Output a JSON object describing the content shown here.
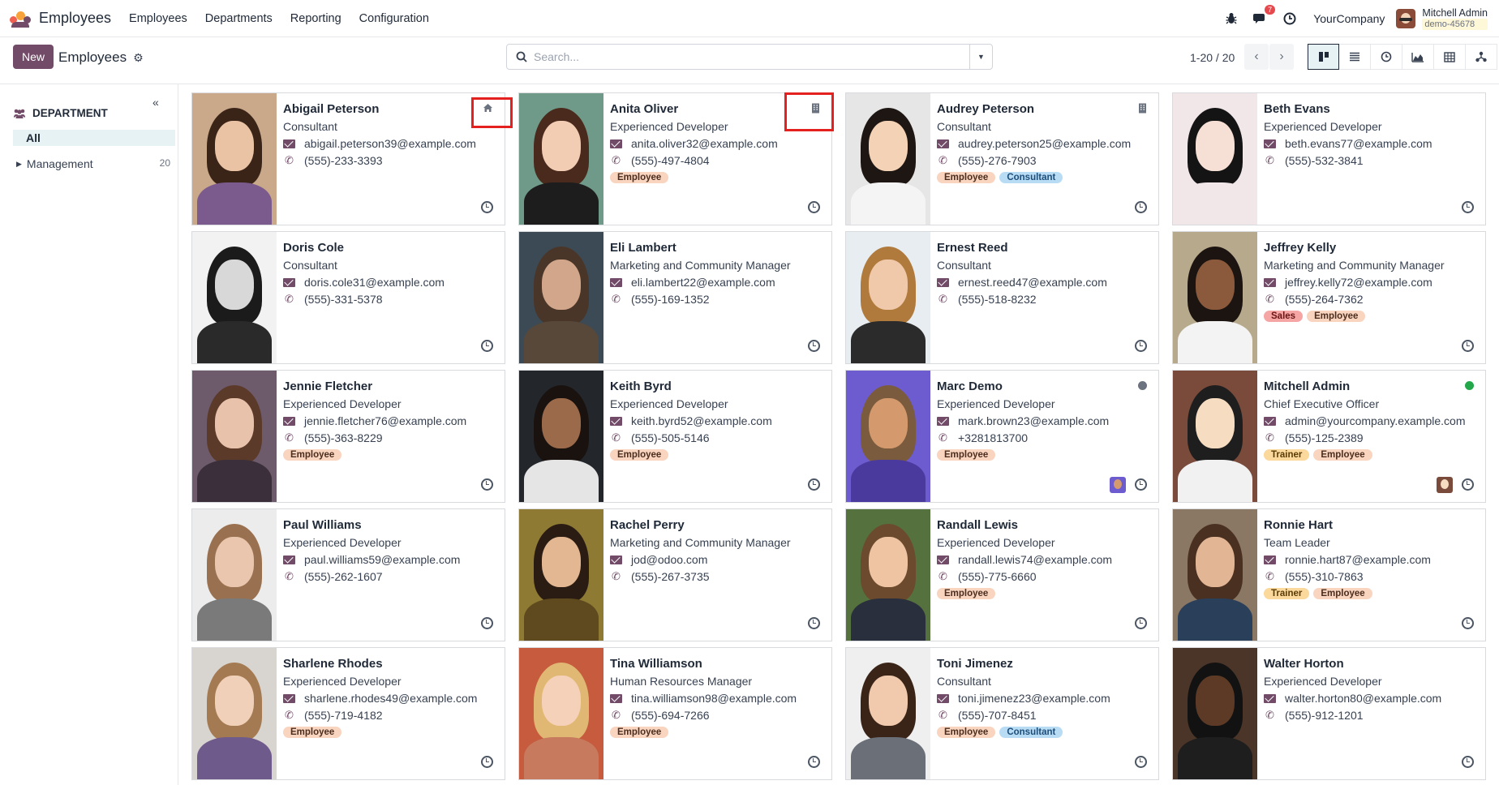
{
  "app": {
    "title": "Employees",
    "menu": [
      "Employees",
      "Departments",
      "Reporting",
      "Configuration"
    ],
    "notification_count": "7",
    "company": "YourCompany",
    "user_name": "Mitchell Admin",
    "database": "demo-45678"
  },
  "control": {
    "new_label": "New",
    "breadcrumb": "Employees",
    "search_placeholder": "Search...",
    "pager": "1-20 / 20"
  },
  "sidebar": {
    "header": "DEPARTMENT",
    "all_label": "All",
    "items": [
      {
        "label": "Management",
        "count": "20"
      }
    ]
  },
  "colors": {
    "brand": "#714b67",
    "highlight": "#e5211f",
    "online": "#22a84a",
    "offline": "#6b7280"
  },
  "employees": [
    {
      "name": "Abigail Peterson",
      "job": "Consultant",
      "email": "abigail.peterson39@example.com",
      "phone": "(555)-233-3393",
      "tags": [],
      "corner_icon": "home-icon"
    },
    {
      "name": "Anita Oliver",
      "job": "Experienced Developer",
      "email": "anita.oliver32@example.com",
      "phone": "(555)-497-4804",
      "tags": [
        "Employee"
      ],
      "corner_icon": "building-icon"
    },
    {
      "name": "Audrey Peterson",
      "job": "Consultant",
      "email": "audrey.peterson25@example.com",
      "phone": "(555)-276-7903",
      "tags": [
        "Employee",
        "Consultant"
      ],
      "corner_icon": "building-icon"
    },
    {
      "name": "Beth Evans",
      "job": "Experienced Developer",
      "email": "beth.evans77@example.com",
      "phone": "(555)-532-3841",
      "tags": []
    },
    {
      "name": "Doris Cole",
      "job": "Consultant",
      "email": "doris.cole31@example.com",
      "phone": "(555)-331-5378",
      "tags": []
    },
    {
      "name": "Eli Lambert",
      "job": "Marketing and Community Manager",
      "email": "eli.lambert22@example.com",
      "phone": "(555)-169-1352",
      "tags": []
    },
    {
      "name": "Ernest Reed",
      "job": "Consultant",
      "email": "ernest.reed47@example.com",
      "phone": "(555)-518-8232",
      "tags": []
    },
    {
      "name": "Jeffrey Kelly",
      "job": "Marketing and Community Manager",
      "email": "jeffrey.kelly72@example.com",
      "phone": "(555)-264-7362",
      "tags": [
        "Sales",
        "Employee"
      ]
    },
    {
      "name": "Jennie Fletcher",
      "job": "Experienced Developer",
      "email": "jennie.fletcher76@example.com",
      "phone": "(555)-363-8229",
      "tags": [
        "Employee"
      ]
    },
    {
      "name": "Keith Byrd",
      "job": "Experienced Developer",
      "email": "keith.byrd52@example.com",
      "phone": "(555)-505-5146",
      "tags": [
        "Employee"
      ]
    },
    {
      "name": "Marc Demo",
      "job": "Experienced Developer",
      "email": "mark.brown23@example.com",
      "phone": "+3281813700",
      "tags": [
        "Employee"
      ],
      "status": "offline",
      "mini_avatar": true
    },
    {
      "name": "Mitchell Admin",
      "job": "Chief Executive Officer",
      "email": "admin@yourcompany.example.com",
      "phone": "(555)-125-2389",
      "tags": [
        "Trainer",
        "Employee"
      ],
      "status": "online",
      "mini_avatar": true
    },
    {
      "name": "Paul Williams",
      "job": "Experienced Developer",
      "email": "paul.williams59@example.com",
      "phone": "(555)-262-1607",
      "tags": []
    },
    {
      "name": "Rachel Perry",
      "job": "Marketing and Community Manager",
      "email": "jod@odoo.com",
      "phone": "(555)-267-3735",
      "tags": []
    },
    {
      "name": "Randall Lewis",
      "job": "Experienced Developer",
      "email": "randall.lewis74@example.com",
      "phone": "(555)-775-6660",
      "tags": [
        "Employee"
      ]
    },
    {
      "name": "Ronnie Hart",
      "job": "Team Leader",
      "email": "ronnie.hart87@example.com",
      "phone": "(555)-310-7863",
      "tags": [
        "Trainer",
        "Employee"
      ]
    },
    {
      "name": "Sharlene Rhodes",
      "job": "Experienced Developer",
      "email": "sharlene.rhodes49@example.com",
      "phone": "(555)-719-4182",
      "tags": [
        "Employee"
      ]
    },
    {
      "name": "Tina Williamson",
      "job": "Human Resources Manager",
      "email": "tina.williamson98@example.com",
      "phone": "(555)-694-7266",
      "tags": [
        "Employee"
      ]
    },
    {
      "name": "Toni Jimenez",
      "job": "Consultant",
      "email": "toni.jimenez23@example.com",
      "phone": "(555)-707-8451",
      "tags": [
        "Employee",
        "Consultant"
      ]
    },
    {
      "name": "Walter Horton",
      "job": "Experienced Developer",
      "email": "walter.horton80@example.com",
      "phone": "(555)-912-1201",
      "tags": []
    }
  ]
}
